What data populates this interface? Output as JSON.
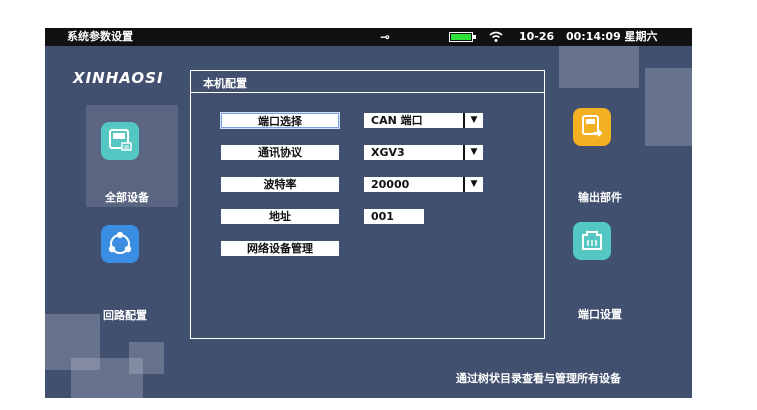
{
  "status": {
    "title": "系统参数设置",
    "usb_icon": "usb-icon",
    "battery_level": 1.0,
    "date": "10-26",
    "time": "00:14:09 星期六"
  },
  "logo": "XINHAOSI",
  "left_nav": [
    {
      "label": "全部设备",
      "icon": "computer-icon",
      "color": "#55c7c3",
      "selected": true
    },
    {
      "label": "回路配置",
      "icon": "share-icon",
      "color": "#3a8de0",
      "selected": false
    }
  ],
  "right_nav": [
    {
      "label": "输出部件",
      "icon": "output-icon",
      "color": "#f4b023"
    },
    {
      "label": "端口设置",
      "icon": "ethernet-port-icon",
      "color": "#55c7c3"
    }
  ],
  "panel": {
    "title": "本机配置",
    "rows": [
      {
        "label": "端口选择",
        "value": "CAN 端口",
        "dropdown": true,
        "focused": true
      },
      {
        "label": "通讯协议",
        "value": "XGV3",
        "dropdown": true,
        "focused": false
      },
      {
        "label": "波特率",
        "value": "20000",
        "dropdown": true,
        "focused": false
      },
      {
        "label": "地址",
        "value": "001",
        "dropdown": false,
        "focused": false
      }
    ],
    "manage_button": "网络设备管理",
    "dropdown_glyph": "▼"
  },
  "footer": "通过树状目录查看与管理所有设备"
}
